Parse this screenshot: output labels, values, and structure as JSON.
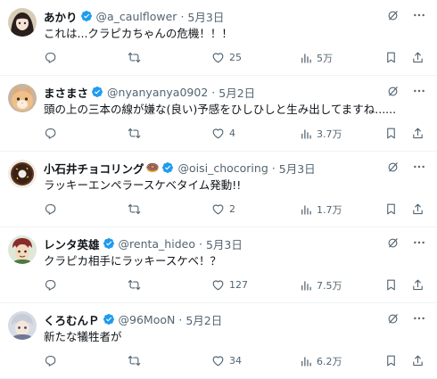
{
  "colors": {
    "verified": "#1d9bf0",
    "muted": "#536471",
    "text": "#0f1419"
  },
  "tweets": [
    {
      "name": "あかり",
      "handle": "@a_caulflower",
      "dot": "·",
      "date": "5月3日",
      "text": "これは...クラピカちゃんの危機！！！",
      "replies": "",
      "retweets": "",
      "likes": "25",
      "views": "5万"
    },
    {
      "name": "まさまさ",
      "handle": "@nyanyanya0902",
      "dot": "·",
      "date": "5月2日",
      "text": "頭の上の三本の線が嫌な(良い)予感をひしひしと生み出してますね......",
      "replies": "",
      "retweets": "",
      "likes": "4",
      "views": "3.7万"
    },
    {
      "name": "小石井チョコリング",
      "name_emoji": "🍩",
      "handle": "@oisi_chocoring",
      "dot": "·",
      "date": "5月3日",
      "text": "ラッキーエンペラースケベタイム発動!!",
      "replies": "",
      "retweets": "",
      "likes": "2",
      "views": "1.7万"
    },
    {
      "name": "レンタ英雄",
      "handle": "@renta_hideo",
      "dot": "·",
      "date": "5月3日",
      "text": "クラピカ相手にラッキースケベ！？",
      "replies": "",
      "retweets": "",
      "likes": "127",
      "views": "7.5万"
    },
    {
      "name": "くろむんＰ",
      "handle": "@96MooN",
      "dot": "·",
      "date": "5月2日",
      "text": "新たな犠牲者が",
      "replies": "",
      "retweets": "",
      "likes": "34",
      "views": "6.2万"
    }
  ]
}
